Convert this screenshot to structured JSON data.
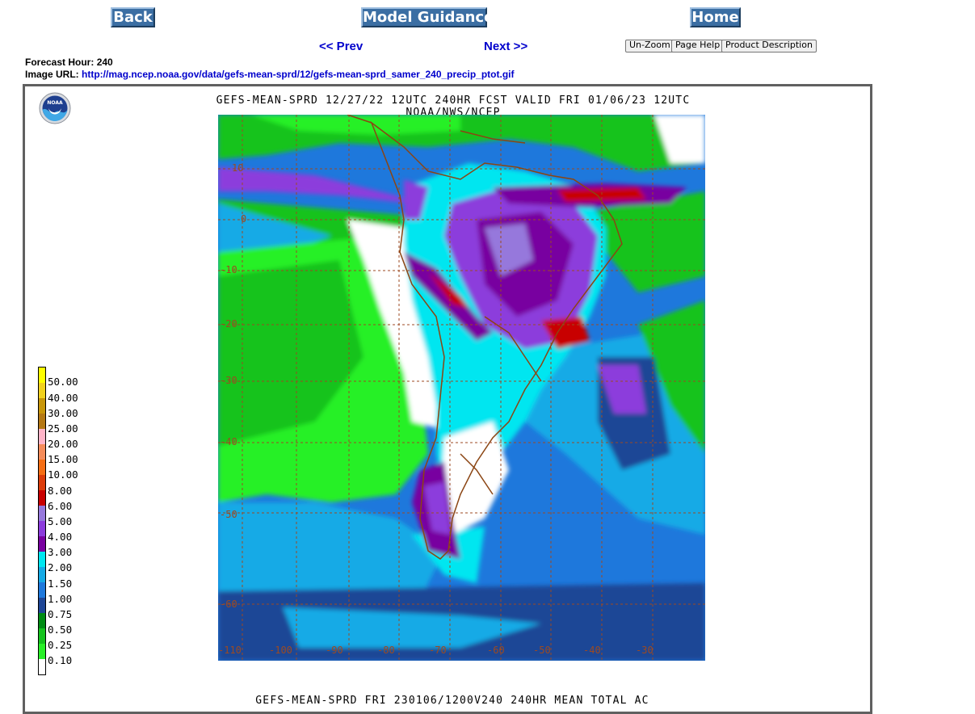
{
  "nav": {
    "back_label": "Back",
    "model_guidance_label": "Model Guidance",
    "home_label": "Home",
    "prev_label": "<< Prev",
    "next_label": "Next >>"
  },
  "controls": {
    "unzoom_label": "Un-Zoom",
    "page_help_label": "Page Help",
    "product_description_label": "Product Description"
  },
  "info": {
    "forecast_hour_label": "Forecast Hour:",
    "forecast_hour_value": "240",
    "image_url_label": "Image URL:",
    "image_url_value": "http://mag.ncep.noaa.gov/data/gefs-mean-sprd/12/gefs-mean-sprd_samer_240_precip_ptot.gif"
  },
  "map": {
    "logo_text": "NOAA",
    "title": "GEFS-MEAN-SPRD 12/27/22 12UTC 240HR FCST VALID FRI 01/06/23 12UTC NOAA/NWS/NCEP",
    "footer": "GEFS-MEAN-SPRD FRI 230106/1200V240 240HR MEAN TOTAL AC",
    "lat_labels": [
      "10",
      "0",
      "-10",
      "-20",
      "-30",
      "-40",
      "-50",
      "-60"
    ],
    "lon_labels": [
      "-110",
      "-100",
      "-90",
      "-80",
      "-70",
      "-60",
      "-50",
      "-40",
      "-30"
    ]
  },
  "legend": {
    "labels": [
      "50.00",
      "40.00",
      "30.00",
      "25.00",
      "20.00",
      "15.00",
      "10.00",
      "8.00",
      "6.00",
      "5.00",
      "4.00",
      "3.00",
      "2.00",
      "1.50",
      "1.00",
      "0.75",
      "0.50",
      "0.25",
      "0.10"
    ],
    "colors": [
      "#ffff00",
      "#f2d21e",
      "#c8960a",
      "#b47814",
      "#ffb4c8",
      "#f58c5a",
      "#f56e14",
      "#dc3c0a",
      "#c80000",
      "#9678dc",
      "#8c3cdc",
      "#7800a0",
      "#00e6f0",
      "#14aae6",
      "#1e78dc",
      "#1e4696",
      "#008c14",
      "#14c31e",
      "#28f028",
      "#ffffff"
    ]
  },
  "colors": {
    "nav_button": "#3b6ea3",
    "link": "#0000cc",
    "frame_border": "#606060",
    "grid_line": "#9c4a22",
    "coastline": "#8b4513"
  }
}
